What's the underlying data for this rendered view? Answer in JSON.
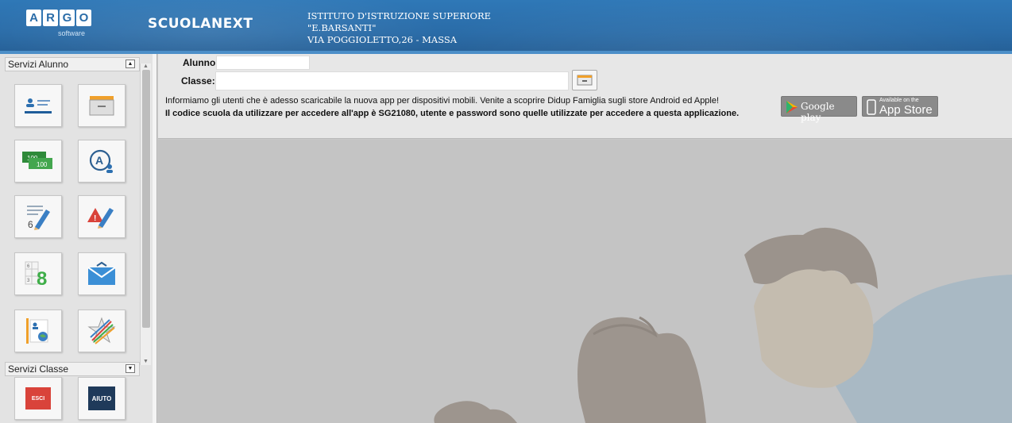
{
  "header": {
    "logo_letters": [
      "A",
      "R",
      "G",
      "O"
    ],
    "logo_subtitle": "software",
    "brand": "SCUOLANEXT",
    "school_line1": "ISTITUTO D'ISTRUZIONE SUPERIORE",
    "school_line2": "\"E.BARSANTI\"",
    "school_line3": "VIA POGGIOLETTO,26 - MASSA"
  },
  "sidebar": {
    "section1_title": "Servizi Alunno",
    "section2_title": "Servizi Classe",
    "tiles": [
      {
        "icon": "student-card-icon"
      },
      {
        "icon": "archive-drawer-icon"
      },
      {
        "icon": "banknotes-icon"
      },
      {
        "icon": "user-a-icon"
      },
      {
        "icon": "grade-pencil-icon"
      },
      {
        "icon": "alert-pencil-icon"
      },
      {
        "icon": "grade-8-icon"
      },
      {
        "icon": "envelope-icon"
      },
      {
        "icon": "student-globe-icon"
      },
      {
        "icon": "colorful-star-icon"
      }
    ],
    "exit_label": "ESCI",
    "help_label": "AIUTO"
  },
  "main": {
    "alunno_label": "Alunno:",
    "classe_label": "Classe:",
    "alunno_value": "",
    "classe_value": "",
    "info_line1": "Informiamo gli utenti che è adesso scaricabile la nuova app per dispositivi mobili. Venite a scoprire Didup Famiglia sugli store Android ed Apple!",
    "info_line2": "Il codice scuola da utilizzare per accedere all'app è SG21080, utente e password sono quelle utilizzate per accedere a questa applicazione.",
    "google_play_label": "Google play",
    "app_store_small": "Available on the",
    "app_store_label": "App Store"
  },
  "colors": {
    "header_blue": "#2a6ca8",
    "exit_red": "#d9433a",
    "help_navy": "#1f3a5a"
  }
}
